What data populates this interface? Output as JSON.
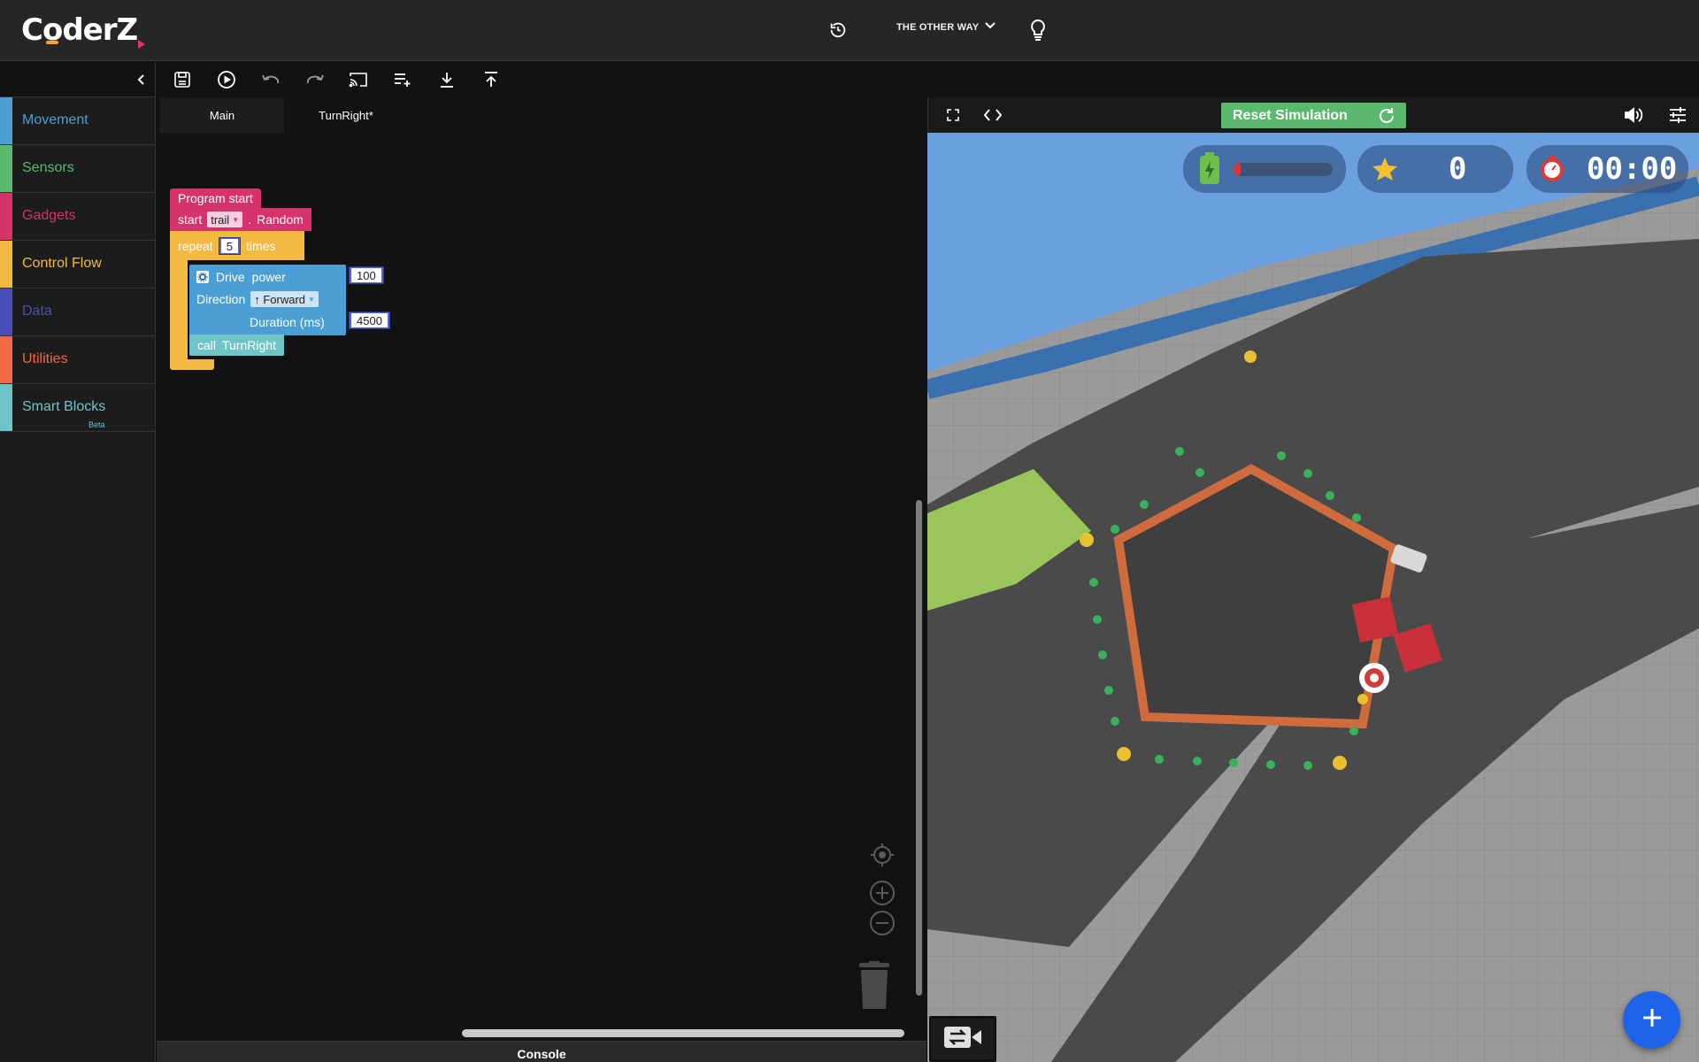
{
  "app": {
    "logo_text": "CoderZ"
  },
  "header": {
    "mission_label": "THE OTHER WAY",
    "icons": [
      "history-icon",
      "chevron-down-icon",
      "lightbulb-icon"
    ]
  },
  "sidebar": {
    "categories": [
      {
        "label": "Movement",
        "color": "#4b9fd5"
      },
      {
        "label": "Sensors",
        "color": "#5bb96d"
      },
      {
        "label": "Gadgets",
        "color": "#d6336c"
      },
      {
        "label": "Control Flow",
        "color": "#f4b942"
      },
      {
        "label": "Data",
        "color": "#4a4db5"
      },
      {
        "label": "Utilities",
        "color": "#f06b45"
      },
      {
        "label": "Smart Blocks",
        "color": "#6fc4c8",
        "badge": "Beta"
      }
    ]
  },
  "toolbar": {
    "icons": [
      "save-icon",
      "run-icon",
      "undo-icon",
      "redo-icon",
      "cast-icon",
      "add-function-icon",
      "download-icon",
      "upload-icon"
    ]
  },
  "tabs": {
    "items": [
      {
        "label": "Main",
        "active": true
      },
      {
        "label": "TurnRight*",
        "active": false
      }
    ]
  },
  "blocks": {
    "program_start": "Program start",
    "start": "start",
    "trail": "trail",
    "separator": ".",
    "random": "Random",
    "repeat": "repeat",
    "repeat_count": "5",
    "times": "times",
    "drive": "Drive",
    "power": "power",
    "power_value": "100",
    "direction": "Direction",
    "direction_value": "↑ Forward",
    "duration": "Duration (ms)",
    "duration_value": "4500",
    "call": "call",
    "function_name": "TurnRight"
  },
  "console": {
    "label": "Console"
  },
  "simulation": {
    "reset_label": "Reset Simulation",
    "battery_level": 0.04,
    "score": "0",
    "timer": "00:00"
  },
  "colors": {
    "movement": "#4b9fd5",
    "events": "#d6336c",
    "control": "#f4b942",
    "functions": "#6fc4c8",
    "reset": "#5bb96d",
    "fab": "#1e63e9"
  }
}
